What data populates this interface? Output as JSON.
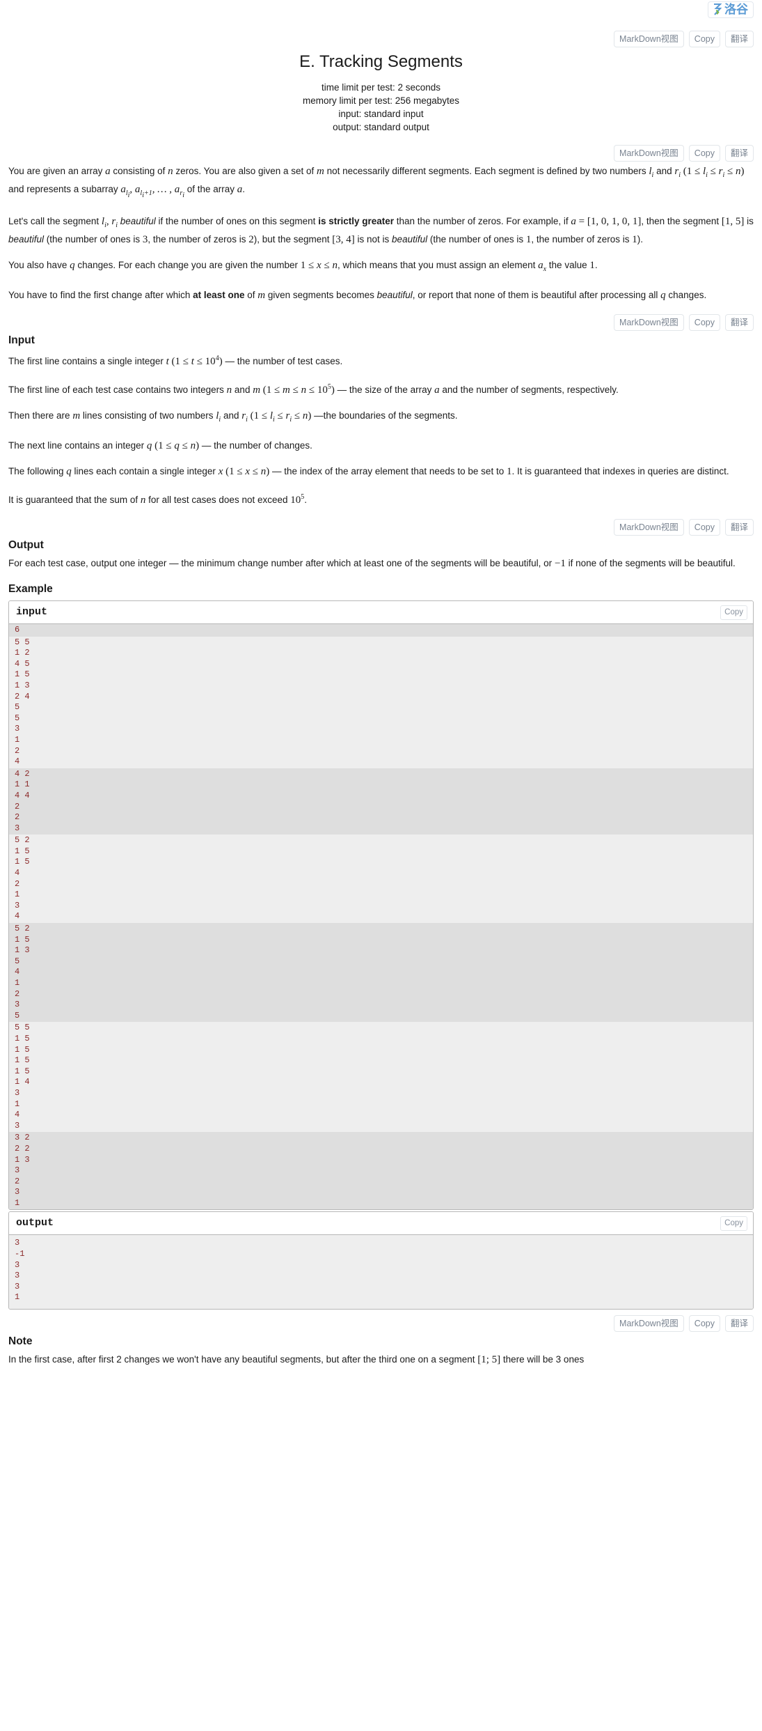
{
  "site": {
    "logo_text": "洛谷",
    "logo_icon": "luogu-logo-icon"
  },
  "toolbar": {
    "markdown_label": "MarkDown视图",
    "copy_label": "Copy",
    "translate_label": "翻译"
  },
  "problem": {
    "title": "E. Tracking Segments",
    "time_limit": "time limit per test: 2 seconds",
    "memory_limit": "memory limit per test: 256 megabytes",
    "input_mode": "input: standard input",
    "output_mode": "output: standard output"
  },
  "statement": {
    "p1_a": "You are given an array ",
    "p1_var_a": "a",
    "p1_b": " consisting of ",
    "p1_var_n": "n",
    "p1_c": " zeros. You are also given a set of ",
    "p1_var_m": "m",
    "p1_d": " not necessarily different segments. Each segment is defined by two numbers ",
    "p1_li": "l",
    "p1_li_sub": "i",
    "p1_e": " and ",
    "p1_ri": "r",
    "p1_ri_sub": "i",
    "p1_f": " (1 ≤ l",
    "p1_g": " ≤ r",
    "p1_h": " ≤ n) and represents a subarray ",
    "p1_sub1": "a",
    "p1_sub1_sub": "l",
    "p1_i": ", a",
    "p1_j": ", … , a",
    "p1_k": " of the array ",
    "p1_l": ".",
    "p2_a": "Let's call the segment ",
    "p2_b": " beautiful if the number of ones on this segment ",
    "p2_strong": "is strictly greater",
    "p2_c": " than the number of zeros. For example, if ",
    "p2_eq": "a = [1, 0, 1, 0, 1]",
    "p2_d": ", then the segment ",
    "p2_seg15": "[1, 5]",
    "p2_e": " is ",
    "p2_beautiful": "beautiful",
    "p2_f": " (the number of ones is ",
    "p2_three": "3",
    "p2_g": ", the number of zeros is ",
    "p2_two": "2",
    "p2_h": "), but the segment ",
    "p2_seg34": "[3, 4]",
    "p2_i": " is not is ",
    "p2_j": " (the number of ones is ",
    "p2_one": "1",
    "p2_k": ", the number of zeros is ",
    "p2_l": ").",
    "p3_a": "You also have ",
    "p3_q": "q",
    "p3_b": " changes. For each change you are given the number ",
    "p3_range": "1 ≤ x ≤ n",
    "p3_c": ", which means that you must assign an element ",
    "p3_ax": "a",
    "p3_ax_sub": "x",
    "p3_d": " the value ",
    "p3_one": "1",
    "p3_e": ".",
    "p4_a": "You have to find the first change after which ",
    "p4_strong": "at least one",
    "p4_b": " of ",
    "p4_m": "m",
    "p4_c": " given segments becomes ",
    "p4_beautiful": "beautiful",
    "p4_d": ", or report that none of them is beautiful after processing all ",
    "p4_q": "q",
    "p4_e": " changes."
  },
  "input_section": {
    "heading": "Input",
    "l1_a": "The first line contains a single integer ",
    "l1_t": "t",
    "l1_b": " (1 ≤ t ≤ 10",
    "l1_exp": "4",
    "l1_c": ") — the number of test cases.",
    "l2_a": "The first line of each test case contains two integers ",
    "l2_n": "n",
    "l2_b": " and ",
    "l2_m": "m",
    "l2_c": " (1 ≤ m ≤ n ≤ 10",
    "l2_exp": "5",
    "l2_d": ") — the size of the array ",
    "l2_arr": "a",
    "l2_e": " and the number of segments, respectively.",
    "l3_a": "Then there are ",
    "l3_m": "m",
    "l3_b": " lines consisting of two numbers ",
    "l3_li": "l",
    "l3_c": " and ",
    "l3_ri": "r",
    "l3_d": " (1 ≤ l",
    "l3_e": " ≤ r",
    "l3_f": " ≤ n) —the boundaries of the segments.",
    "l4_a": "The next line contains an integer ",
    "l4_q": "q",
    "l4_b": " (1 ≤ q ≤ n) — the number of changes.",
    "l5_a": "The following ",
    "l5_q": "q",
    "l5_b": " lines each contain a single integer ",
    "l5_x": "x",
    "l5_c": " (1 ≤ x ≤ n) — the index of the array element that needs to be set to ",
    "l5_one": "1",
    "l5_d": ". It is guaranteed that indexes in queries are distinct.",
    "l6_a": "It is guaranteed that the sum of ",
    "l6_n": "n",
    "l6_b": " for all test cases does not exceed 10",
    "l6_exp": "5",
    "l6_c": "."
  },
  "output_section": {
    "heading": "Output",
    "l1_a": "For each test case, output one integer  — the minimum change number after which at least one of the segments will be beautiful, or ",
    "l1_neg": "−1",
    "l1_b": " if none of the segments will be beautiful."
  },
  "example_section": {
    "heading": "Example",
    "input_label": "input",
    "output_label": "output",
    "copy_label": "Copy"
  },
  "sample": {
    "input_groups": [
      {
        "lines": [
          "6"
        ]
      },
      {
        "lines": [
          "5 5",
          "1 2",
          "4 5",
          "1 5",
          "1 3",
          "2 4",
          "5",
          "5",
          "3",
          "1",
          "2",
          "4"
        ]
      },
      {
        "lines": [
          "4 2",
          "1 1",
          "4 4",
          "2",
          "2",
          "3"
        ]
      },
      {
        "lines": [
          "5 2",
          "1 5",
          "1 5",
          "4",
          "2",
          "1",
          "3",
          "4"
        ]
      },
      {
        "lines": [
          "5 2",
          "1 5",
          "1 3",
          "5",
          "4",
          "1",
          "2",
          "3",
          "5"
        ]
      },
      {
        "lines": [
          "5 5",
          "1 5",
          "1 5",
          "1 5",
          "1 5",
          "1 4",
          "3",
          "1",
          "4",
          "3"
        ]
      },
      {
        "lines": [
          "3 2",
          "2 2",
          "1 3",
          "3",
          "2",
          "3",
          "1"
        ]
      }
    ],
    "output_lines": [
      "3",
      "-1",
      "3",
      "3",
      "3",
      "1"
    ]
  },
  "note_section": {
    "heading": "Note",
    "l1_a": "In the first case, after first 2 changes we won't have any beautiful segments, but after the third one on a segment ",
    "l1_seg": "[1; 5]",
    "l1_b": " there will be 3 ones"
  },
  "colors": {
    "logo_blue": "#5b9bd5",
    "sample_text": "#8c2b2b",
    "stripe_odd": "#eeeeee",
    "stripe_even": "#dedede",
    "button_text": "#7a8491"
  }
}
